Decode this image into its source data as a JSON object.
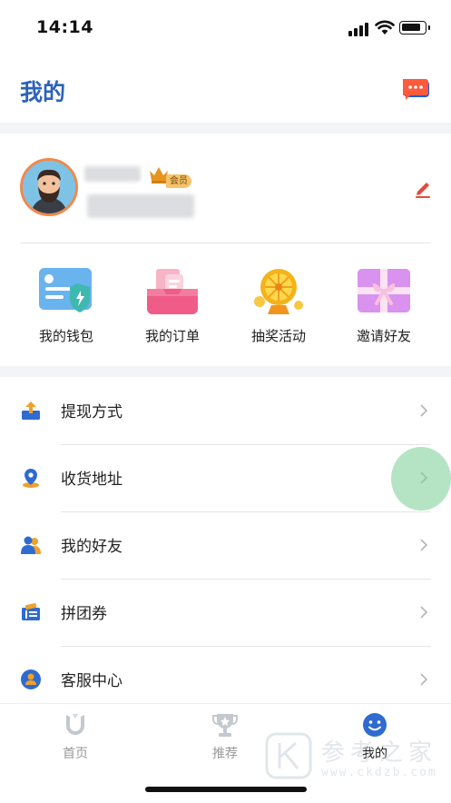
{
  "status_bar": {
    "time": "14:14"
  },
  "header": {
    "title": "我的"
  },
  "profile": {
    "badge": "会员"
  },
  "quick_actions": [
    {
      "label": "我的钱包",
      "icon": "wallet-icon"
    },
    {
      "label": "我的订单",
      "icon": "orders-icon"
    },
    {
      "label": "抽奖活动",
      "icon": "lottery-wheel-icon"
    },
    {
      "label": "邀请好友",
      "icon": "gift-box-icon"
    }
  ],
  "menu": [
    {
      "label": "提现方式",
      "icon": "withdraw-icon"
    },
    {
      "label": "收货地址",
      "icon": "location-pin-icon"
    },
    {
      "label": "我的好友",
      "icon": "friends-icon"
    },
    {
      "label": "拼团券",
      "icon": "coupon-icon"
    },
    {
      "label": "客服中心",
      "icon": "customer-service-icon"
    }
  ],
  "tabs": [
    {
      "label": "首页",
      "icon": "home-tab-icon",
      "active": false
    },
    {
      "label": "推荐",
      "icon": "trophy-icon",
      "active": false
    },
    {
      "label": "我的",
      "icon": "smiley-icon",
      "active": true
    }
  ],
  "watermark": {
    "main": "参考之家",
    "url": "www.ckdzb.com"
  },
  "colors": {
    "accent": "#2b63b8",
    "avatar_ring": "#f08a4b",
    "message_icon": "#ff5a3c",
    "edit_icon": "#e8483a"
  }
}
